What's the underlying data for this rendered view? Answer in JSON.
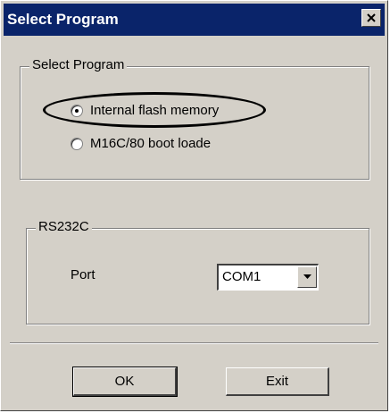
{
  "window": {
    "title": "Select Program",
    "close_glyph": "✕"
  },
  "program_group": {
    "legend": "Select Program",
    "options": [
      {
        "label": "Internal flash memory",
        "selected": true,
        "highlighted": true
      },
      {
        "label": "M16C/80 boot loade",
        "selected": false,
        "highlighted": false
      }
    ]
  },
  "rs232c_group": {
    "legend": "RS232C",
    "port_label": "Port",
    "port_value": "COM1",
    "dropdown_icon": "chevron-down-icon"
  },
  "buttons": {
    "ok_label": "OK",
    "exit_label": "Exit"
  },
  "colors": {
    "titlebar": "#0a246a",
    "dialog_face": "#d4d0c8"
  }
}
